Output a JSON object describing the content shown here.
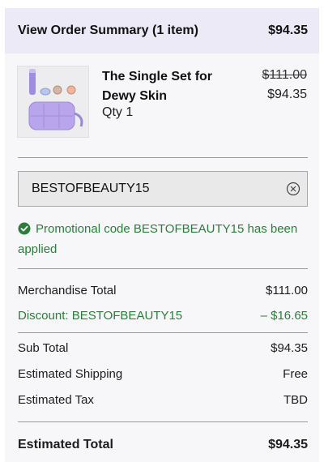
{
  "header": {
    "title": "View Order Summary (1 item)",
    "total": "$94.35"
  },
  "item": {
    "image": "product-set-image",
    "name_line1": "The Single Set for",
    "name_line2": "Dewy Skin",
    "qty": "Qty 1",
    "price_original": "$111.00",
    "price_current": "$94.35"
  },
  "promo": {
    "code_value": "BESTOFBEAUTY15",
    "clear_icon": "clear-circle-x-icon",
    "success_icon": "check-circle-icon",
    "success_text": "Promotional code BESTOFBEAUTY15 has been applied"
  },
  "summary": {
    "merch_label": "Merchandise Total",
    "merch_value": "$111.00",
    "discount_label": "Discount: BESTOFBEAUTY15",
    "discount_value": "– $16.65",
    "subtotal_label": "Sub Total",
    "subtotal_value": "$94.35",
    "shipping_label": "Estimated Shipping",
    "shipping_value": "Free",
    "tax_label": "Estimated Tax",
    "tax_value": "TBD",
    "total_label": "Estimated Total",
    "total_value": "$94.35"
  },
  "colors": {
    "header_bg": "#eceaf7",
    "success": "#2c7d3b",
    "accent_purple": "#b6a6e8"
  }
}
